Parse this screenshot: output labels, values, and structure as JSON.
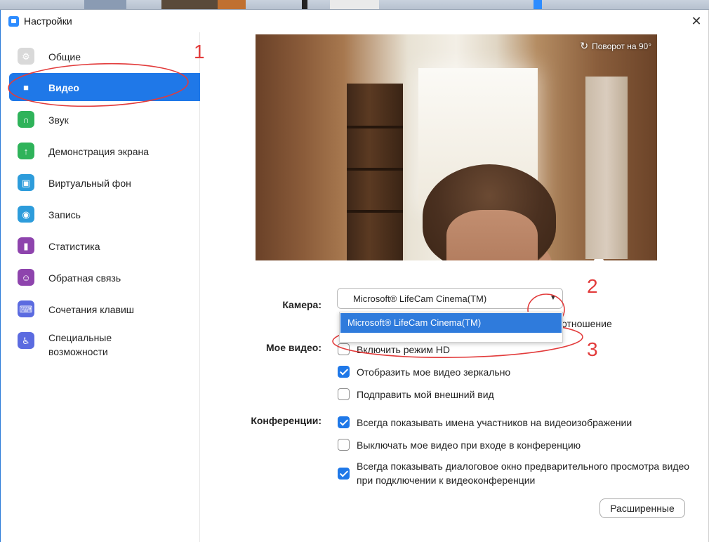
{
  "window": {
    "title": "Настройки",
    "close_glyph": "✕"
  },
  "sidebar": {
    "items": [
      {
        "label": "Общие",
        "icon": "gear-icon",
        "color": "#d9d9d9",
        "glyph": "⚙"
      },
      {
        "label": "Видео",
        "icon": "video-camera-icon",
        "color": "#1f78e8",
        "glyph": "■"
      },
      {
        "label": "Звук",
        "icon": "headphones-icon",
        "color": "#2fb35a",
        "glyph": "∩"
      },
      {
        "label": "Демонстрация экрана",
        "icon": "share-screen-icon",
        "color": "#2fb35a",
        "glyph": "↑"
      },
      {
        "label": "Виртуальный фон",
        "icon": "virtual-background-icon",
        "color": "#2d9cdb",
        "glyph": "▣"
      },
      {
        "label": "Запись",
        "icon": "record-icon",
        "color": "#2d9cdb",
        "glyph": "◉"
      },
      {
        "label": "Статистика",
        "icon": "statistics-icon",
        "color": "#8e44ad",
        "glyph": "▮"
      },
      {
        "label": "Обратная связь",
        "icon": "feedback-icon",
        "color": "#8e44ad",
        "glyph": "☺"
      },
      {
        "label": "Сочетания клавиш",
        "icon": "keyboard-icon",
        "color": "#5b6be0",
        "glyph": "⌨"
      },
      {
        "label": "Специальные возможности",
        "icon": "accessibility-icon",
        "color": "#5b6be0",
        "glyph": "♿"
      }
    ],
    "active_index": 1
  },
  "preview": {
    "rotate_label": "Поворот на 90°",
    "rotate_glyph": "↻"
  },
  "camera": {
    "label": "Камера:",
    "selected": "Microsoft® LifeCam Cinema(TM)",
    "arrow_glyph": "▼",
    "dropdown_options": [
      "Microsoft® LifeCam Cinema(TM)"
    ],
    "partial_hidden_text": "отношение"
  },
  "my_video": {
    "label": "Мое видео:",
    "options": [
      {
        "label": "Включить режим HD",
        "checked": false
      },
      {
        "label": "Отобразить мое видео зеркально",
        "checked": true
      },
      {
        "label": "Подправить мой внешний вид",
        "checked": false
      }
    ]
  },
  "meetings": {
    "label": "Конференции:",
    "options": [
      {
        "label": "Всегда показывать имена участников на видеоизображении",
        "checked": true
      },
      {
        "label": "Выключать мое видео при входе в конференцию",
        "checked": false
      },
      {
        "label": "Всегда показывать диалоговое окно предварительного просмотра видео при подключении к видеоконференции",
        "checked": true
      }
    ]
  },
  "advanced_button": "Расширенные",
  "annotations": {
    "color": "#e23b3b",
    "numbers": [
      "1",
      "2",
      "3"
    ]
  }
}
